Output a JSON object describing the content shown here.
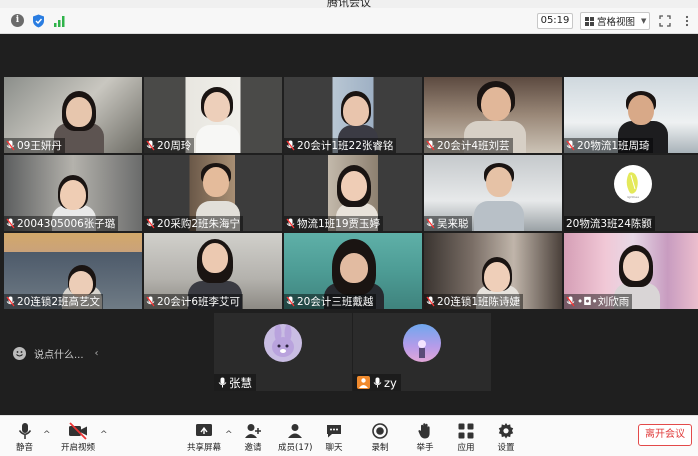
{
  "window": {
    "title": "腾讯会议"
  },
  "topbar": {
    "timer": "05:19",
    "view_label": "宫格视图"
  },
  "participants": [
    {
      "name": "09王妍丹"
    },
    {
      "name": "20周玲"
    },
    {
      "name": "20会计1班22张睿铭"
    },
    {
      "name": "20会计4班刘芸"
    },
    {
      "name": "20物流1班周琦"
    },
    {
      "name": "2004305006张子璐"
    },
    {
      "name": "20采购2班朱海宁"
    },
    {
      "name": "物流1班19贾玉婷"
    },
    {
      "name": "吴来聪"
    },
    {
      "name": "20物流3班24陈颢"
    },
    {
      "name": "20连锁2班高艺文"
    },
    {
      "name": "20会计6班李艾可"
    },
    {
      "name": "20会计三班戴越"
    },
    {
      "name": "20连锁1班陈诗婕"
    },
    {
      "name": "•◘•刘欣雨"
    }
  ],
  "audio_participants": [
    {
      "name": "张慧"
    },
    {
      "name": "zy"
    }
  ],
  "chat": {
    "placeholder": "说点什么..."
  },
  "toolbar": {
    "mute": "静音",
    "video": "开启视频",
    "share": "共享屏幕",
    "invite": "邀请",
    "members": "成员(17)",
    "chat": "聊天",
    "record": "录制",
    "raise_hand": "举手",
    "apps": "应用",
    "settings": "设置",
    "leave": "离开会议"
  }
}
